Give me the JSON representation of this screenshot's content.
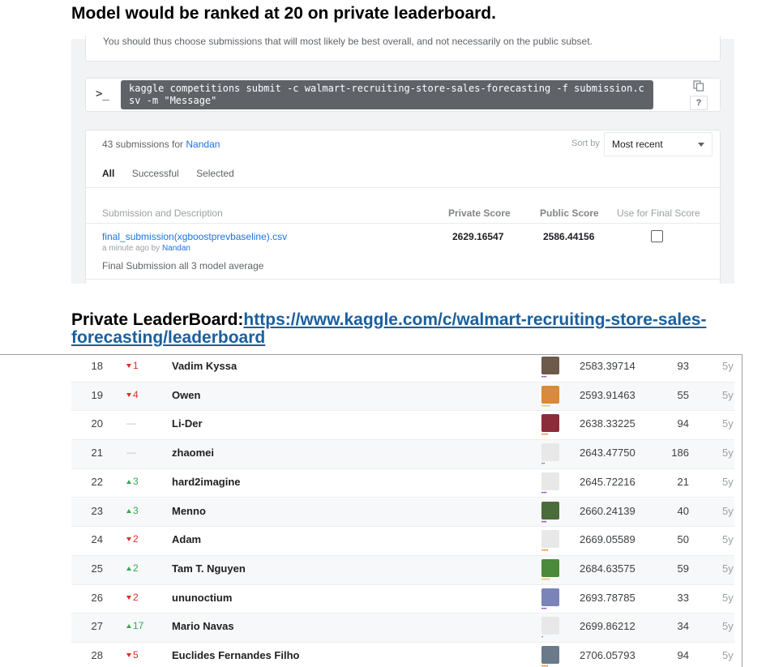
{
  "heading1": "Model would be ranked at 20 on private leaderboard.",
  "note": "You should thus choose submissions that will most likely be best overall, and not necessarily on the public subset.",
  "cli": {
    "prompt": ">_",
    "command": "kaggle competitions submit -c walmart-recruiting-store-sales-forecasting -f submission.csv -m \"Message\"",
    "copy_icon": "copy-icon",
    "help": "?"
  },
  "submissions": {
    "count_text": "43 submissions for",
    "user": "Nandan",
    "sort_label": "Sort by",
    "sort_value": "Most recent",
    "tabs": [
      "All",
      "Successful",
      "Selected"
    ],
    "columns": [
      "Submission and Description",
      "Private Score",
      "Public Score",
      "Use for Final Score"
    ],
    "row": {
      "file": "final_submission(xgboostprevbaseline).csv",
      "time": "a minute ago by",
      "by": "Nandan",
      "description": "Final Submission all 3 model average",
      "private_score": "2629.16547",
      "public_score": "2586.44156",
      "use_for_final": false
    }
  },
  "heading2": {
    "label": "Private LeaderBoard:",
    "link": "https://www.kaggle.com/c/walmart-recruiting-store-sales-forecasting/leaderboard"
  },
  "leaderboard": [
    {
      "rank": "18",
      "dir": "down",
      "delta": "1",
      "team": "Vadim Kyssa",
      "score": "2583.39714",
      "entries": "93",
      "last": "5y",
      "tier_color": "#7b1fa2",
      "tier": "•••",
      "avatar": "#6d5a4a"
    },
    {
      "rank": "19",
      "dir": "down",
      "delta": "4",
      "team": "Owen",
      "score": "2593.91463",
      "entries": "55",
      "last": "5y",
      "tier_color": "#f9a825",
      "tier": "•••••",
      "avatar": "#d98a3a"
    },
    {
      "rank": "20",
      "dir": "none",
      "delta": "—",
      "team": "Li-Der",
      "score": "2638.33225",
      "entries": "94",
      "last": "5y",
      "tier_color": "#ef6c00",
      "tier": "••••",
      "avatar": "#8b2c3b"
    },
    {
      "rank": "21",
      "dir": "none",
      "delta": "—",
      "team": "zhaomei",
      "score": "2643.47750",
      "entries": "186",
      "last": "5y",
      "tier_color": "#1e88e5",
      "tier": "••",
      "avatar": "#e8e8e8"
    },
    {
      "rank": "22",
      "dir": "up",
      "delta": "3",
      "team": "hard2imagine",
      "score": "2645.72216",
      "entries": "21",
      "last": "5y",
      "tier_color": "#7b1fa2",
      "tier": "•••",
      "avatar": "#e8e8e8"
    },
    {
      "rank": "23",
      "dir": "up",
      "delta": "3",
      "team": "Menno",
      "score": "2660.24139",
      "entries": "40",
      "last": "5y",
      "tier_color": "#7b1fa2",
      "tier": "•••",
      "avatar": "#4a6b3a"
    },
    {
      "rank": "24",
      "dir": "down",
      "delta": "2",
      "team": "Adam",
      "score": "2669.05589",
      "entries": "50",
      "last": "5y",
      "tier_color": "#ef6c00",
      "tier": "••••",
      "avatar": "#e8e8e8"
    },
    {
      "rank": "25",
      "dir": "up",
      "delta": "2",
      "team": "Tam T. Nguyen",
      "score": "2684.63575",
      "entries": "59",
      "last": "5y",
      "tier_color": "#f9a825",
      "tier": "•••••",
      "avatar": "#4a8a3a"
    },
    {
      "rank": "26",
      "dir": "down",
      "delta": "2",
      "team": "ununoctium",
      "score": "2693.78785",
      "entries": "33",
      "last": "5y",
      "tier_color": "#7b1fa2",
      "tier": "•••",
      "avatar": "#7a84b8"
    },
    {
      "rank": "27",
      "dir": "up",
      "delta": "17",
      "team": "Mario Navas",
      "score": "2699.86212",
      "entries": "34",
      "last": "5y",
      "tier_color": "#43a047",
      "tier": "•",
      "avatar": "#e8e8e8"
    },
    {
      "rank": "28",
      "dir": "down",
      "delta": "5",
      "team": "Euclides Fernandes Filho",
      "score": "2706.05793",
      "entries": "94",
      "last": "5y",
      "tier_color": "#ef6c00",
      "tier": "••••",
      "avatar": "#6a7a8a"
    }
  ]
}
